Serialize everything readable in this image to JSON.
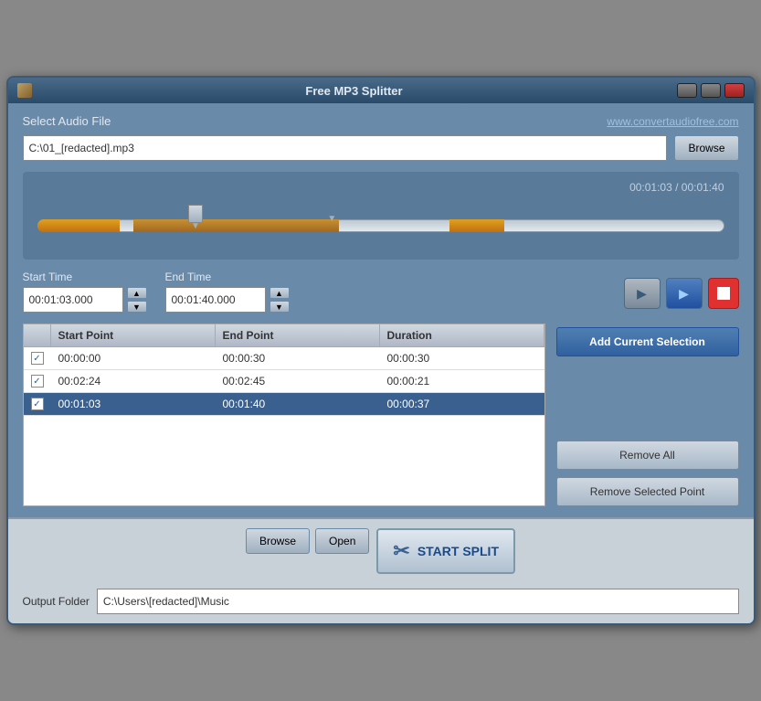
{
  "window": {
    "title": "Free MP3 Splitter"
  },
  "header": {
    "select_label": "Select Audio File",
    "website": "www.convertaudiofree.com",
    "file_path": "C:\\01_[redacted].mp3"
  },
  "timeline": {
    "current_time": "00:01:03",
    "total_time": "00:01:40",
    "time_display": "00:01:03 / 00:01:40"
  },
  "controls": {
    "start_label": "Start Time",
    "start_value": "00:01:03.000",
    "end_label": "End Time",
    "end_value": "00:01:40.000",
    "up_arrow": "▲",
    "down_arrow": "▼"
  },
  "buttons": {
    "browse_top": "Browse",
    "add_selection": "Add Current Selection",
    "remove_all": "Remove All",
    "remove_selected": "Remove Selected Point",
    "browse_bottom": "Browse",
    "open": "Open",
    "start_split": "START SPLIT"
  },
  "table": {
    "headers": [
      "",
      "Start Point",
      "End Point",
      "Duration"
    ],
    "rows": [
      {
        "checked": true,
        "start": "00:00:00",
        "end": "00:00:30",
        "duration": "00:00:30",
        "selected": false
      },
      {
        "checked": true,
        "start": "00:02:24",
        "end": "00:02:45",
        "duration": "00:00:21",
        "selected": false
      },
      {
        "checked": true,
        "start": "00:01:03",
        "end": "00:01:40",
        "duration": "00:00:37",
        "selected": true
      }
    ]
  },
  "bottom": {
    "output_label": "Output Folder",
    "output_path": "C:\\Users\\[redacted]\\Music"
  }
}
